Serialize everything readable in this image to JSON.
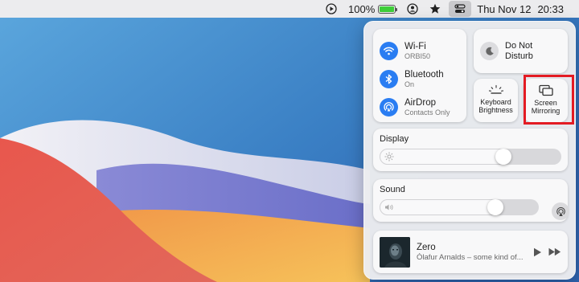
{
  "menubar": {
    "battery_percent": "100%",
    "battery_level": 1.0,
    "date": "Thu Nov 12",
    "time": "20:33"
  },
  "control_center": {
    "wifi": {
      "title": "Wi-Fi",
      "subtitle": "ORBI50"
    },
    "bluetooth": {
      "title": "Bluetooth",
      "subtitle": "On"
    },
    "airdrop": {
      "title": "AirDrop",
      "subtitle": "Contacts Only"
    },
    "do_not_disturb": {
      "line1": "Do Not",
      "line2": "Disturb"
    },
    "keyboard_brightness": {
      "line1": "Keyboard",
      "line2": "Brightness"
    },
    "screen_mirroring": {
      "line1": "Screen",
      "line2": "Mirroring"
    },
    "display": {
      "label": "Display",
      "level": 0.7
    },
    "sound": {
      "label": "Sound",
      "level": 0.75
    },
    "now_playing": {
      "title": "Zero",
      "artist": "Ólafur Arnalds – some kind of..."
    }
  },
  "colors": {
    "accent": "#2a7df2",
    "highlight": "#e31b23",
    "battery_green": "#3fcf3a"
  }
}
